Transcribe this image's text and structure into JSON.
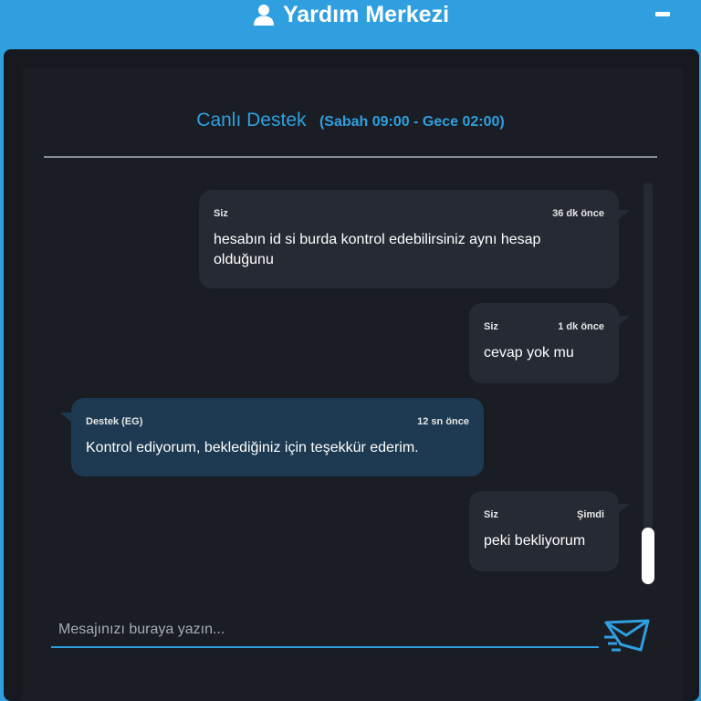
{
  "header": {
    "title": "Yardım Merkezi",
    "icon": "user-icon",
    "minimize_icon": "minimize-icon"
  },
  "chat": {
    "title": "Canlı Destek",
    "hours": "(Sabah 09:00 - Gece 02:00)"
  },
  "messages": [
    {
      "direction": "outgoing",
      "sender": "Siz",
      "time": "36 dk önce",
      "text": "hesabın id si burda kontrol edebilirsiniz aynı hesap olduğunu"
    },
    {
      "direction": "outgoing",
      "sender": "Siz",
      "time": "1 dk önce",
      "text": "cevap yok mu"
    },
    {
      "direction": "incoming",
      "sender": "Destek (EG)",
      "time": "12 sn önce",
      "text": "Kontrol ediyorum, beklediğiniz için teşekkür ederim."
    },
    {
      "direction": "outgoing",
      "sender": "Siz",
      "time": "Şimdi",
      "text": "peki bekliyorum"
    }
  ],
  "input": {
    "placeholder": "Mesajınızı buraya yazın...",
    "value": ""
  },
  "send_icon": "send-icon",
  "colors": {
    "accent": "#2f9fe0",
    "panel_bg": "#16191f",
    "outgoing_bubble": "#262a33",
    "incoming_bubble": "#1d3a52"
  }
}
